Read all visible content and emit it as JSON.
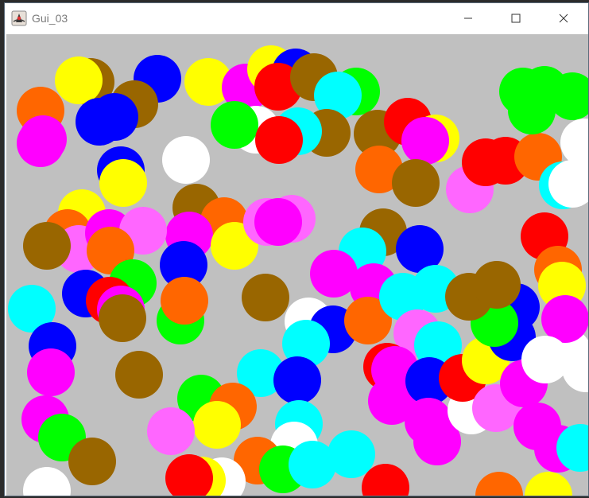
{
  "window": {
    "title": "Gui_03"
  },
  "icons": {
    "app": "java-duke-icon",
    "minimize": "minimize-icon",
    "maximize": "maximize-icon",
    "close": "close-icon"
  },
  "canvas": {
    "background": "#c0c0c0",
    "palette": {
      "orange": "#ff6600",
      "magenta": "#ff00ff",
      "yellow": "#ffff00",
      "brown": "#996600",
      "blue": "#0000ff",
      "green": "#00ff00",
      "red": "#ff0000",
      "cyan": "#00ffff",
      "white": "#ffffff",
      "pink": "#ff66ff"
    }
  }
}
